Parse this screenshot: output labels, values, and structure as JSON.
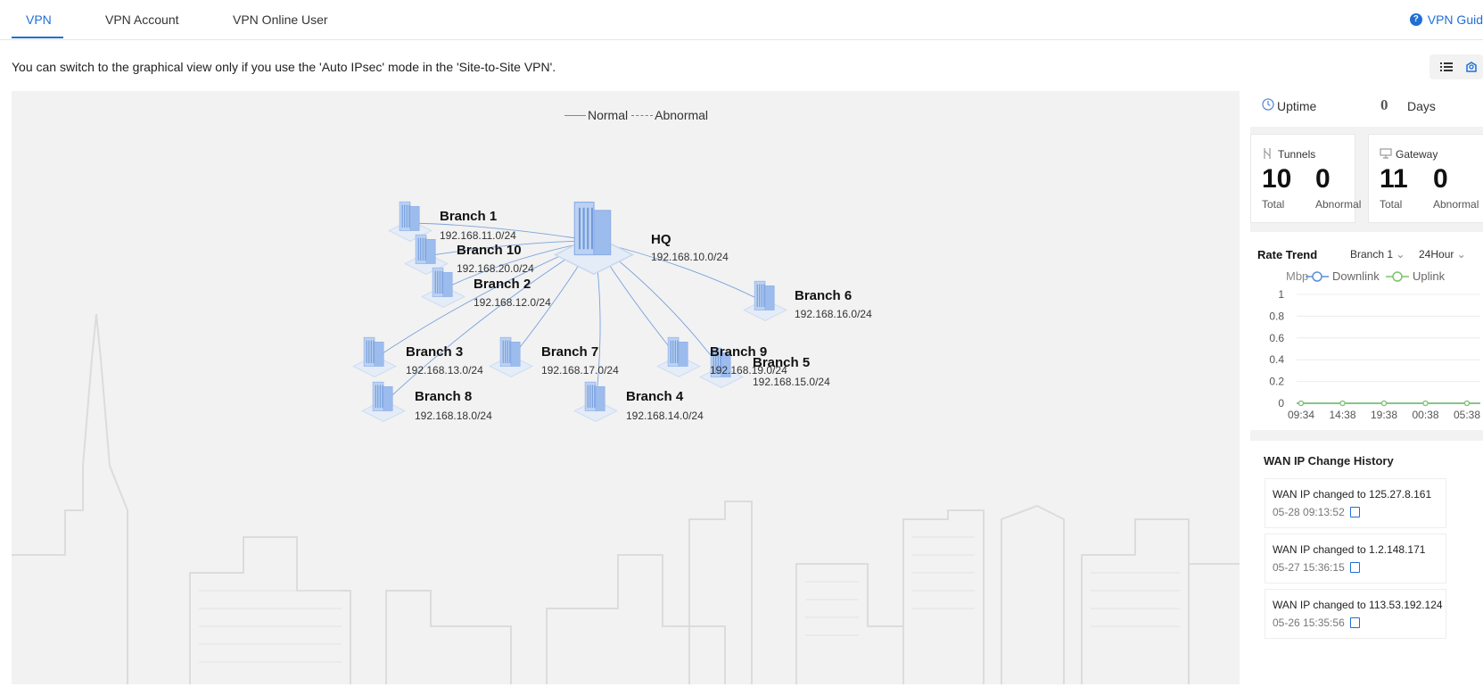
{
  "tabs": [
    {
      "label": "VPN",
      "active": true
    },
    {
      "label": "VPN Account",
      "active": false
    },
    {
      "label": "VPN Online User",
      "active": false
    }
  ],
  "guide_label": "VPN Guid",
  "notice": "You can switch to the graphical view only if you use the 'Auto IPsec' mode in the 'Site-to-Site VPN'.",
  "legend": {
    "normal": "Normal",
    "abnormal": "Abnormal"
  },
  "colors": {
    "accent": "#1f6fd6",
    "normal_line": "#5b8fd8",
    "abnormal_line": "#d9534f",
    "downlink": "#5b8fd8",
    "uplink": "#7cc36a"
  },
  "topology": {
    "hq": {
      "name": "HQ",
      "ip": "192.168.10.0/24"
    },
    "branches": [
      {
        "name": "Branch 1",
        "ip": "192.168.11.0/24"
      },
      {
        "name": "Branch 10",
        "ip": "192.168.20.0/24"
      },
      {
        "name": "Branch 2",
        "ip": "192.168.12.0/24"
      },
      {
        "name": "Branch 6",
        "ip": "192.168.16.0/24"
      },
      {
        "name": "Branch 3",
        "ip": "192.168.13.0/24"
      },
      {
        "name": "Branch 7",
        "ip": "192.168.17.0/24"
      },
      {
        "name": "Branch 9",
        "ip": "192.168.19.0/24"
      },
      {
        "name": "Branch 5",
        "ip": "192.168.15.0/24"
      },
      {
        "name": "Branch 8",
        "ip": "192.168.18.0/24"
      },
      {
        "name": "Branch 4",
        "ip": "192.168.14.0/24"
      }
    ]
  },
  "uptime": {
    "label": "Uptime",
    "value": "0",
    "unit": "Days"
  },
  "tunnels": {
    "title": "Tunnels",
    "total": "10",
    "total_label": "Total",
    "abnormal": "0",
    "abnormal_label": "Abnormal"
  },
  "gateway": {
    "title": "Gateway",
    "total": "11",
    "total_label": "Total",
    "abnormal": "0",
    "abnormal_label": "Abnormal"
  },
  "rate_trend": {
    "title": "Rate Trend",
    "branch_select": "Branch 1",
    "range_select": "24Hour",
    "unit": "Mbp",
    "downlink": "Downlink",
    "uplink": "Uplink"
  },
  "chart_data": {
    "type": "line",
    "x": [
      "09:34",
      "14:38",
      "19:38",
      "00:38",
      "05:38"
    ],
    "series": [
      {
        "name": "Downlink",
        "values": [
          0,
          0,
          0,
          0,
          0
        ]
      },
      {
        "name": "Uplink",
        "values": [
          0,
          0,
          0,
          0,
          0
        ]
      }
    ],
    "yticks": [
      "0",
      "0.2",
      "0.4",
      "0.6",
      "0.8",
      "1"
    ],
    "ylim": [
      0,
      1
    ],
    "ylabel": "Mbp",
    "grid": true
  },
  "wan_history": {
    "title": "WAN IP Change History",
    "items": [
      {
        "text": "WAN IP changed to 125.27.8.161",
        "time": "05-28 09:13:52"
      },
      {
        "text": "WAN IP changed to 1.2.148.171",
        "time": "05-27 15:36:15"
      },
      {
        "text": "WAN IP changed to 113.53.192.124",
        "time": "05-26 15:35:56"
      }
    ]
  }
}
